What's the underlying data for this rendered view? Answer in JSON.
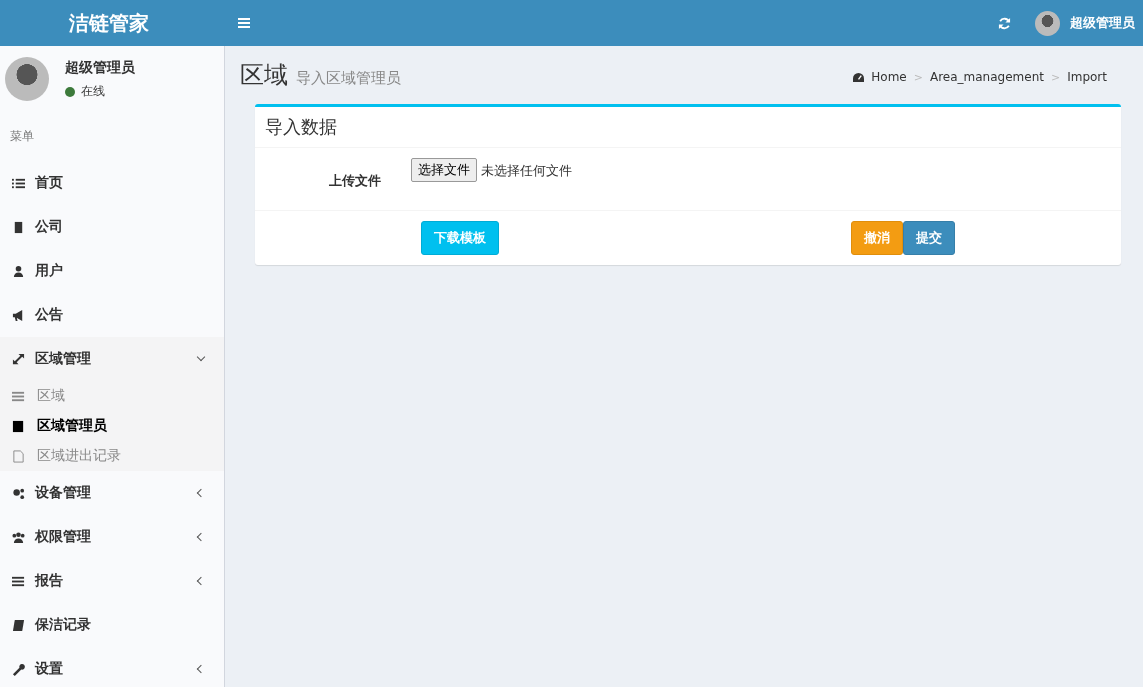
{
  "header": {
    "logo": "洁链管家",
    "user_name": "超级管理员"
  },
  "sidebar": {
    "user": {
      "name": "超级管理员",
      "status": "在线",
      "online": true
    },
    "menu_label": "菜单",
    "items": [
      {
        "label": "首页"
      },
      {
        "label": "公司"
      },
      {
        "label": "用户"
      },
      {
        "label": "公告"
      },
      {
        "label": "区域管理",
        "expanded": true,
        "children": [
          {
            "label": "区域",
            "selected": false
          },
          {
            "label": "区域管理员",
            "selected": true
          },
          {
            "label": "区域进出记录",
            "selected": false
          }
        ]
      },
      {
        "label": "设备管理",
        "expanded": false
      },
      {
        "label": "权限管理",
        "expanded": false
      },
      {
        "label": "报告",
        "expanded": false
      },
      {
        "label": "保洁记录"
      },
      {
        "label": "设置",
        "expanded": false
      }
    ]
  },
  "page": {
    "title": "区域",
    "subtitle": "导入区域管理员",
    "breadcrumb": [
      "Home",
      "Area_management",
      "Import"
    ],
    "separator": ">"
  },
  "card": {
    "title": "导入数据",
    "field_label": "上传文件",
    "file_button": "选择文件",
    "file_status": "未选择任何文件",
    "download_button": "下载模板",
    "cancel_button": "撤消",
    "submit_button": "提交"
  }
}
